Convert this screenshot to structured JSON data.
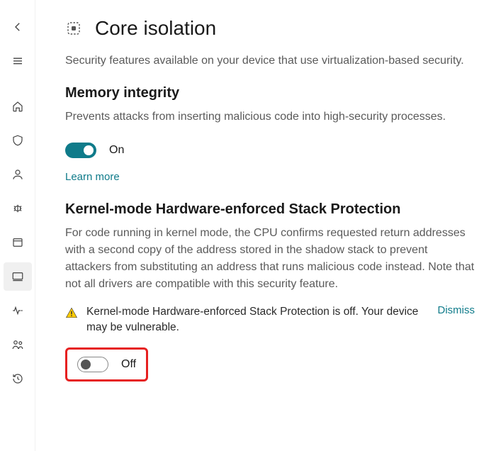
{
  "page": {
    "title": "Core isolation",
    "subtitle": "Security features available on your device that use virtualization-based security."
  },
  "sections": {
    "mem": {
      "title": "Memory integrity",
      "desc": "Prevents attacks from inserting malicious code into high-security processes.",
      "toggle_label": "On",
      "link": "Learn more"
    },
    "kernel": {
      "title": "Kernel-mode Hardware-enforced Stack Protection",
      "desc": "For code running in kernel mode, the CPU confirms requested return addresses with a second copy of the address stored in the shadow stack to prevent attackers from substituting an address that runs malicious code instead. Note that not all drivers are compatible with this security feature.",
      "warning": "Kernel-mode Hardware-enforced Stack Protection is off. Your device may be vulnerable.",
      "dismiss": "Dismiss",
      "toggle_label": "Off"
    }
  }
}
